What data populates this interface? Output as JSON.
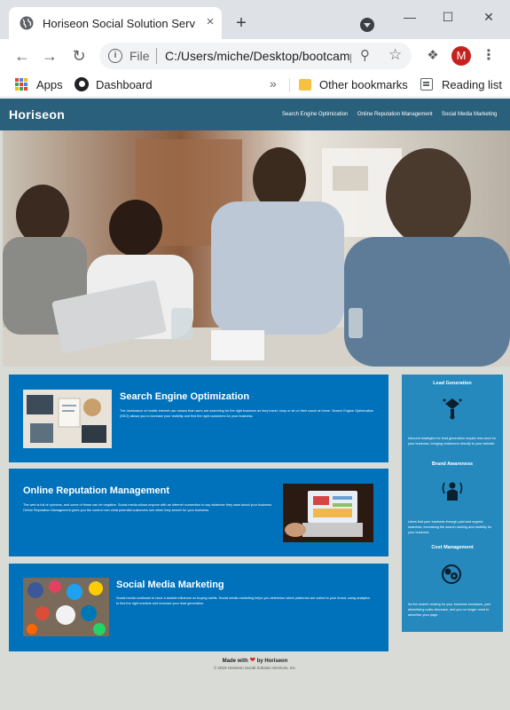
{
  "browser": {
    "tab_title": "Horiseon Social Solution Services, Inc.",
    "tab_close": "×",
    "new_tab": "+",
    "window": {
      "minimize": "—",
      "maximize": "☐",
      "close": "✕"
    },
    "scheme": "File",
    "address": "C:/Users/miche/Desktop/bootcamp/Horiseon/index.html",
    "avatar_letter": "M",
    "bookmarks": {
      "apps": "Apps",
      "dashboard": "Dashboard",
      "overflow": "»",
      "other": "Other bookmarks",
      "reading_list": "Reading list"
    }
  },
  "site": {
    "logo": "Horiseon",
    "nav": [
      "Search Engine Optimization",
      "Online Reputation Management",
      "Social Media Marketing"
    ]
  },
  "sections": [
    {
      "title": "Search Engine Optimization",
      "text": "The dominance of mobile internet use means that users are searching for the right business as they travel, shop or sit on their couch at home. Search Engine Optimization (SEO) allows you to increase your visibility and find the right customers for your business."
    },
    {
      "title": "Online Reputation Management",
      "text": "The web is full of opinions, and some of those can be negative. Social media allows anyone with an internet connection to say whatever they want about your business. Online Reputation Management gives you the control over what potential customers see when they search for your business."
    },
    {
      "title": "Social Media Marketing",
      "text": "Social media continues to have a sizable influence on buying habits. Social media marketing helps you determine which platforms are suited to your brand, using analytics to find the right markets and increase your lead generation."
    }
  ],
  "benefits": [
    {
      "title": "Lead Generation",
      "icon": "lead-generation-icon",
      "text": "Inbound strategies for lead generation require less work for your business, bringing customers directly to your website."
    },
    {
      "title": "Brand Awareness",
      "icon": "brand-awareness-icon",
      "text": "Users find your business through paid and organic searches, increasing the search ranking and visibility for your business."
    },
    {
      "title": "Cost Management",
      "icon": "cost-management-icon",
      "text": "As the search ranking for your business increases, your advertising costs decrease, and you no longer need to advertise your page."
    }
  ],
  "footer": {
    "made_with": "Made with",
    "heart": "❤",
    "by": "by Horiseon",
    "copyright": "© 2019 Horiseon Social Solution Services, Inc."
  },
  "colors": {
    "header": "#2a607c",
    "card": "#0072bb",
    "benefits": "#2589bd",
    "page_bg": "#d9dcd6"
  }
}
